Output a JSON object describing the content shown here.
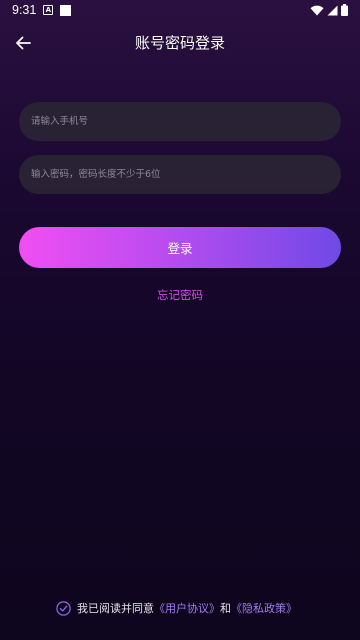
{
  "status_bar": {
    "time": "9:31",
    "notification_icon": "A"
  },
  "header": {
    "back_icon": "arrow-left-icon",
    "title": "账号密码登录"
  },
  "form": {
    "phone_placeholder": "请输入手机号",
    "phone_value": "",
    "password_placeholder": "输入密码，密码长度不少于6位",
    "password_value": "",
    "login_label": "登录",
    "forgot_label": "忘记密码"
  },
  "agreement": {
    "checked": true,
    "prefix": "我已阅读并同意",
    "user_agreement": "《用户协议》",
    "conjunction": "和",
    "privacy_policy": "《隐私政策》"
  },
  "colors": {
    "accent_pink": "#f04ef2",
    "accent_purple": "#6f4ae6",
    "link_purple": "#a07cf0",
    "forgot_pink": "#d04ee6",
    "background": "#120624"
  }
}
